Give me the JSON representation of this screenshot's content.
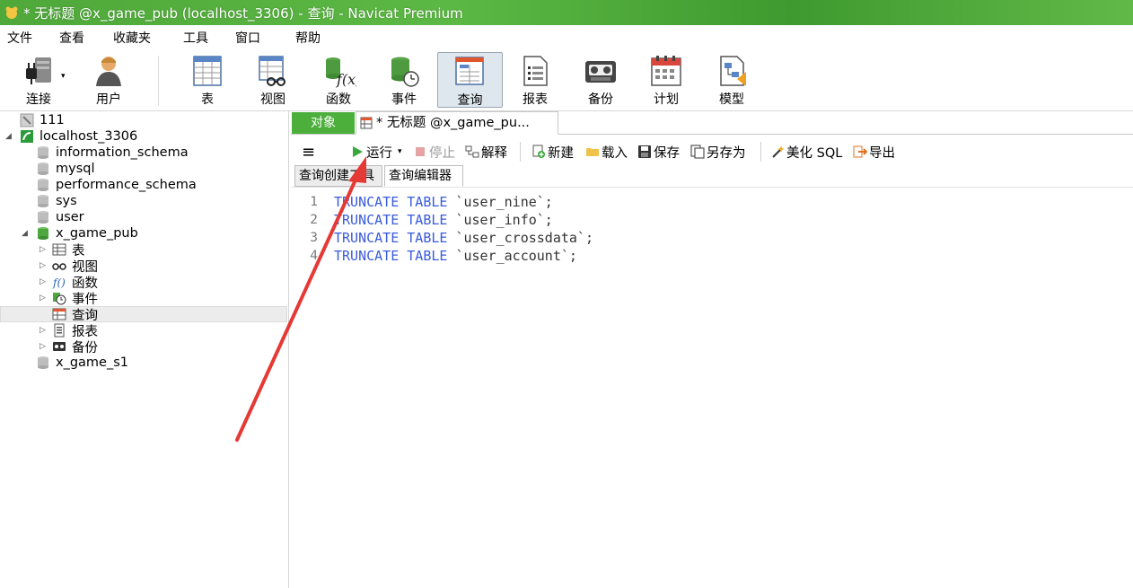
{
  "window": {
    "title": "* 无标题 @x_game_pub (localhost_3306) - 查询 - Navicat Premium"
  },
  "menu": [
    "文件",
    "查看",
    "收藏夹",
    "工具",
    "窗口",
    "帮助"
  ],
  "toolbar": {
    "connect": "连接",
    "user": "用户",
    "table": "表",
    "view": "视图",
    "function": "函数",
    "event": "事件",
    "query": "查询",
    "report": "报表",
    "backup": "备份",
    "schedule": "计划",
    "model": "模型"
  },
  "tree": {
    "conn_111": "111",
    "conn_local": "localhost_3306",
    "db1": "information_schema",
    "db2": "mysql",
    "db3": "performance_schema",
    "db4": "sys",
    "db5": "user",
    "db6": "x_game_pub",
    "child_table": "表",
    "child_view": "视图",
    "child_function": "函数",
    "child_event": "事件",
    "child_query": "查询",
    "child_report": "报表",
    "child_backup": "备份",
    "db7": "x_game_s1"
  },
  "tabs": {
    "objects": "对象",
    "query_tab": "* 无标题 @x_game_pu..."
  },
  "query_toolbar": {
    "menu_icon": "≡",
    "run": "运行",
    "stop": "停止",
    "explain": "解释",
    "new": "新建",
    "load": "载入",
    "save": "保存",
    "save_as": "另存为",
    "beautify": "美化 SQL",
    "export": "导出"
  },
  "subtabs": {
    "builder": "查询创建工具",
    "editor": "查询编辑器"
  },
  "editor": {
    "lines": [
      {
        "n": "1",
        "kw": "TRUNCATE TABLE",
        "rest": " `user_nine`;"
      },
      {
        "n": "2",
        "kw": "TRUNCATE TABLE",
        "rest": " `user_info`;"
      },
      {
        "n": "3",
        "kw": "TRUNCATE TABLE",
        "rest": " `user_crossdata`;"
      },
      {
        "n": "4",
        "kw": "TRUNCATE TABLE",
        "rest": " `user_account`;"
      }
    ]
  },
  "colors": {
    "accent_green": "#4caf3c",
    "keyword_blue": "#3a5bdc",
    "annotation_arrow": "#e53935"
  }
}
